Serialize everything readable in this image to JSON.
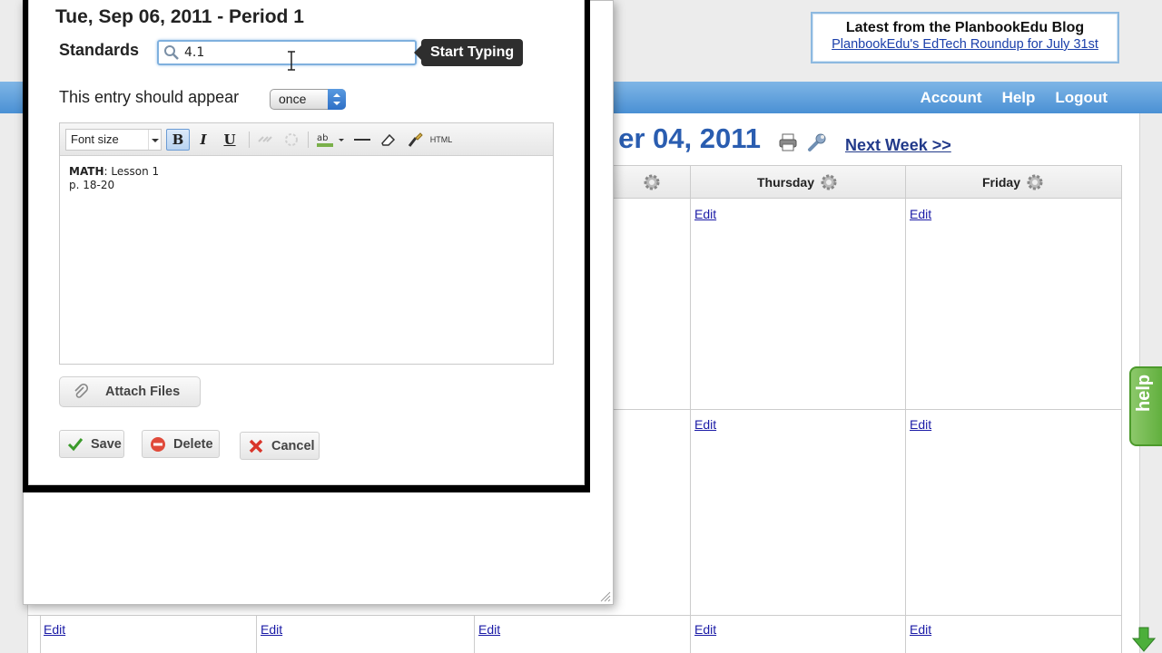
{
  "blog": {
    "title": "Latest from the PlanbookEdu Blog",
    "link": "PlanbookEdu's EdTech Roundup for July 31st"
  },
  "nav": {
    "account": "Account",
    "help": "Help",
    "logout": "Logout"
  },
  "calendar": {
    "week_title": "er 04, 2011",
    "next_week": "Next Week >>",
    "days": [
      "Thursday",
      "Friday"
    ],
    "edit_label": "Edit"
  },
  "help_tab": "help",
  "dialog": {
    "title": "Tue, Sep 06, 2011 - Period 1",
    "standards_label": "Standards",
    "standards_value": "4.1",
    "tooltip": "Start Typing",
    "appear_label": "This entry should appear",
    "appear_value": "once",
    "toolbar": {
      "font_size": "Font size",
      "bold": "B",
      "italic": "I",
      "underline": "U",
      "html": "HTML"
    },
    "editor": {
      "subject": "MATH",
      "line1_rest": ": Lesson 1",
      "line2": "p. 18-20"
    },
    "attach": "Attach Files",
    "save": "Save",
    "delete": "Delete",
    "cancel": "Cancel"
  },
  "colors": {
    "nav_blue": "#4a90d4",
    "title_blue": "#2a5db0",
    "help_green": "#5fae3b"
  }
}
